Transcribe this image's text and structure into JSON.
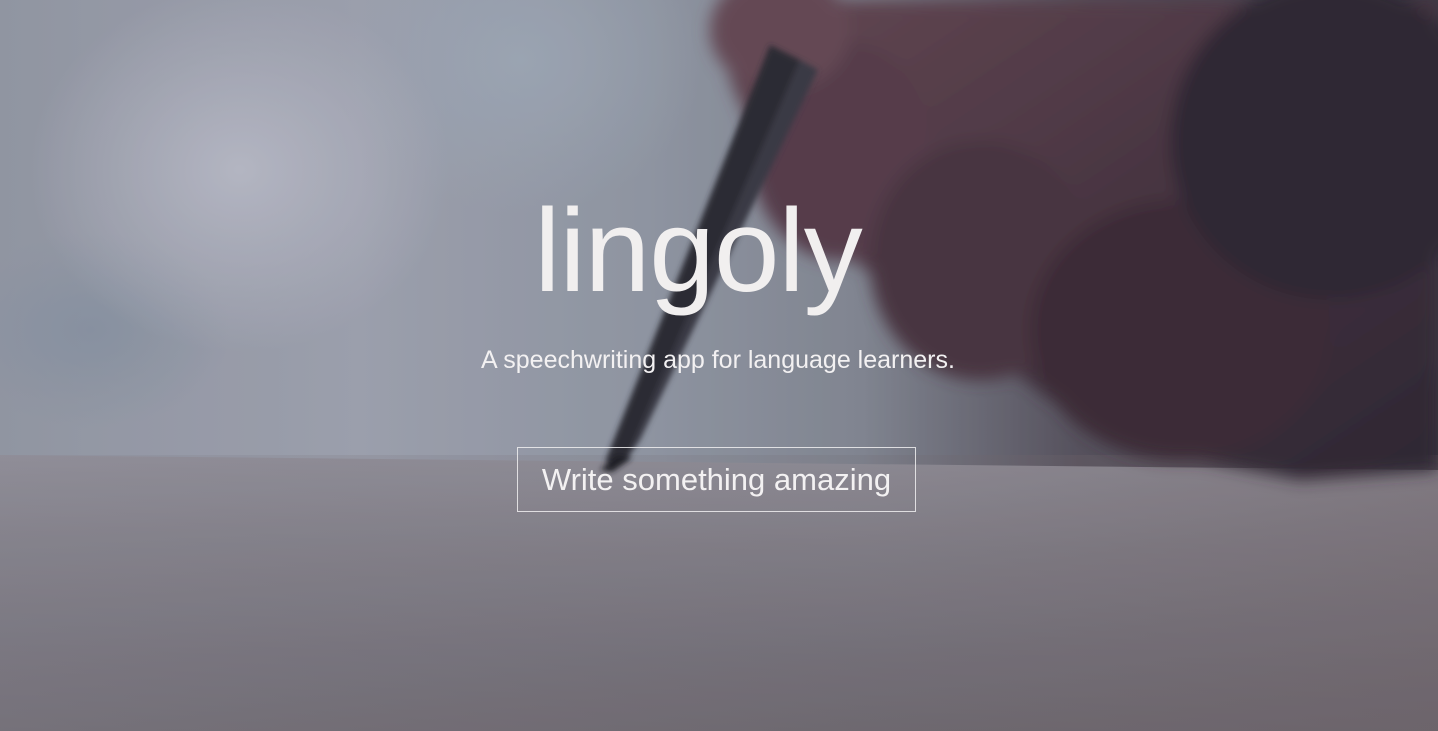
{
  "hero": {
    "logo_text": "lingoly",
    "tagline": "A speechwriting app for language learners.",
    "cta_label": "Write something amazing",
    "background_image": "hand-writing-with-pencil-photo"
  },
  "colors": {
    "text": "#f1efef",
    "button_border": "#f0eef0"
  }
}
